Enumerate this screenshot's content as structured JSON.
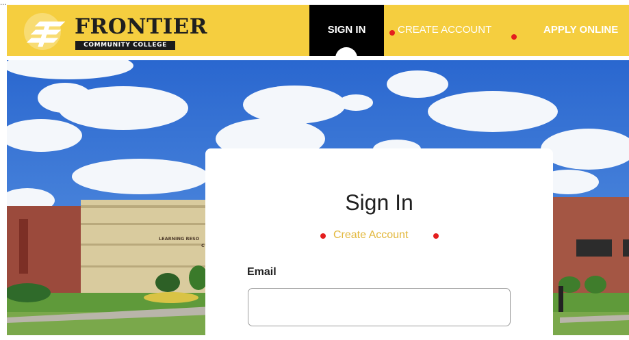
{
  "top_fragment": "...",
  "header": {
    "logo_name": "FRONTIER",
    "logo_subtitle": "COMMUNITY COLLEGE",
    "nav": {
      "sign_in": "SIGN IN",
      "create_account": "CREATE ACCOUNT",
      "apply_online": "APPLY ONLINE"
    },
    "colors": {
      "bar": "#f5ce3f",
      "active_tab": "#000000",
      "marker_dot": "#e41e1e"
    }
  },
  "hero": {
    "building_sign_line1": "LEARNING RESO",
    "building_sign_line2": "C"
  },
  "card": {
    "title": "Sign In",
    "create_account_link": "Create Account",
    "email_label": "Email",
    "email_value": "",
    "link_color": "#e2b73b"
  }
}
